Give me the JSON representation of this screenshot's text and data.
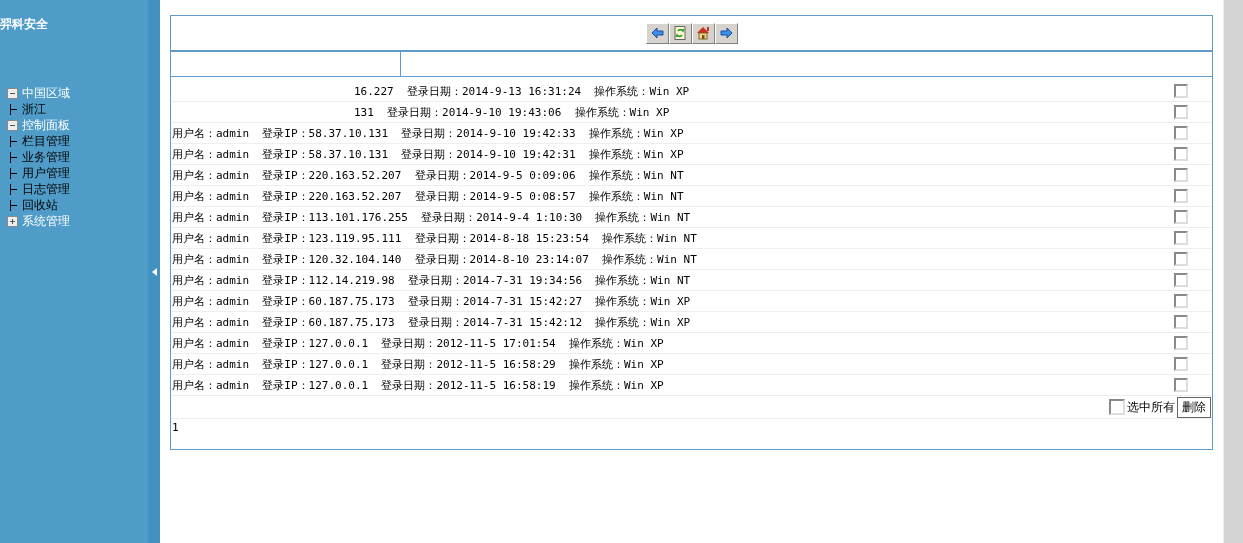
{
  "sidebar": {
    "title": "羿科安全",
    "tree": [
      {
        "label": "中国区域",
        "expanded": true,
        "children": [
          {
            "label": "浙江"
          }
        ]
      },
      {
        "label": "控制面板",
        "expanded": true,
        "children": [
          {
            "label": "栏目管理"
          },
          {
            "label": "业务管理"
          },
          {
            "label": "用户管理"
          },
          {
            "label": "日志管理"
          },
          {
            "label": "回收站"
          }
        ]
      },
      {
        "label": "系统管理",
        "expanded": false
      }
    ]
  },
  "toolbar": {
    "buttons": [
      {
        "kind": "back"
      },
      {
        "kind": "refresh"
      },
      {
        "kind": "home"
      },
      {
        "kind": "forward"
      }
    ]
  },
  "log_rows": [
    {
      "kind": "covered",
      "text": "16.227  登录日期：2014-9-13 16:31:24  操作系统：Win XP",
      "checked": false
    },
    {
      "kind": "covered",
      "text": "131  登录日期：2014-9-10 19:43:06  操作系统：Win XP",
      "checked": false
    },
    {
      "kind": "full",
      "text": "用户名：admin  登录IP：58.37.10.131  登录日期：2014-9-10 19:42:33  操作系统：Win XP",
      "checked": false
    },
    {
      "kind": "full",
      "text": "用户名：admin  登录IP：58.37.10.131  登录日期：2014-9-10 19:42:31  操作系统：Win XP",
      "checked": false
    },
    {
      "kind": "full",
      "text": "用户名：admin  登录IP：220.163.52.207  登录日期：2014-9-5 0:09:06  操作系统：Win NT",
      "checked": false
    },
    {
      "kind": "full",
      "text": "用户名：admin  登录IP：220.163.52.207  登录日期：2014-9-5 0:08:57  操作系统：Win NT",
      "checked": false
    },
    {
      "kind": "full",
      "text": "用户名：admin  登录IP：113.101.176.255  登录日期：2014-9-4 1:10:30  操作系统：Win NT",
      "checked": false
    },
    {
      "kind": "full",
      "text": "用户名：admin  登录IP：123.119.95.111  登录日期：2014-8-18 15:23:54  操作系统：Win NT",
      "checked": false
    },
    {
      "kind": "full",
      "text": "用户名：admin  登录IP：120.32.104.140  登录日期：2014-8-10 23:14:07  操作系统：Win NT",
      "checked": false
    },
    {
      "kind": "full",
      "text": "用户名：admin  登录IP：112.14.219.98  登录日期：2014-7-31 19:34:56  操作系统：Win NT",
      "checked": false
    },
    {
      "kind": "full",
      "text": "用户名：admin  登录IP：60.187.75.173  登录日期：2014-7-31 15:42:27  操作系统：Win XP",
      "checked": false
    },
    {
      "kind": "full",
      "text": "用户名：admin  登录IP：60.187.75.173  登录日期：2014-7-31 15:42:12  操作系统：Win XP",
      "checked": false
    },
    {
      "kind": "full",
      "text": "用户名：admin  登录IP：127.0.0.1  登录日期：2012-11-5 17:01:54  操作系统：Win XP",
      "checked": false
    },
    {
      "kind": "full",
      "text": "用户名：admin  登录IP：127.0.0.1  登录日期：2012-11-5 16:58:29  操作系统：Win XP",
      "checked": false
    },
    {
      "kind": "full",
      "text": "用户名：admin  登录IP：127.0.0.1  登录日期：2012-11-5 16:58:19  操作系统：Win XP",
      "checked": false
    }
  ],
  "footer": {
    "select_all": {
      "label": "选中所有",
      "checked": false
    },
    "delete_button": "删除",
    "page": "1"
  }
}
